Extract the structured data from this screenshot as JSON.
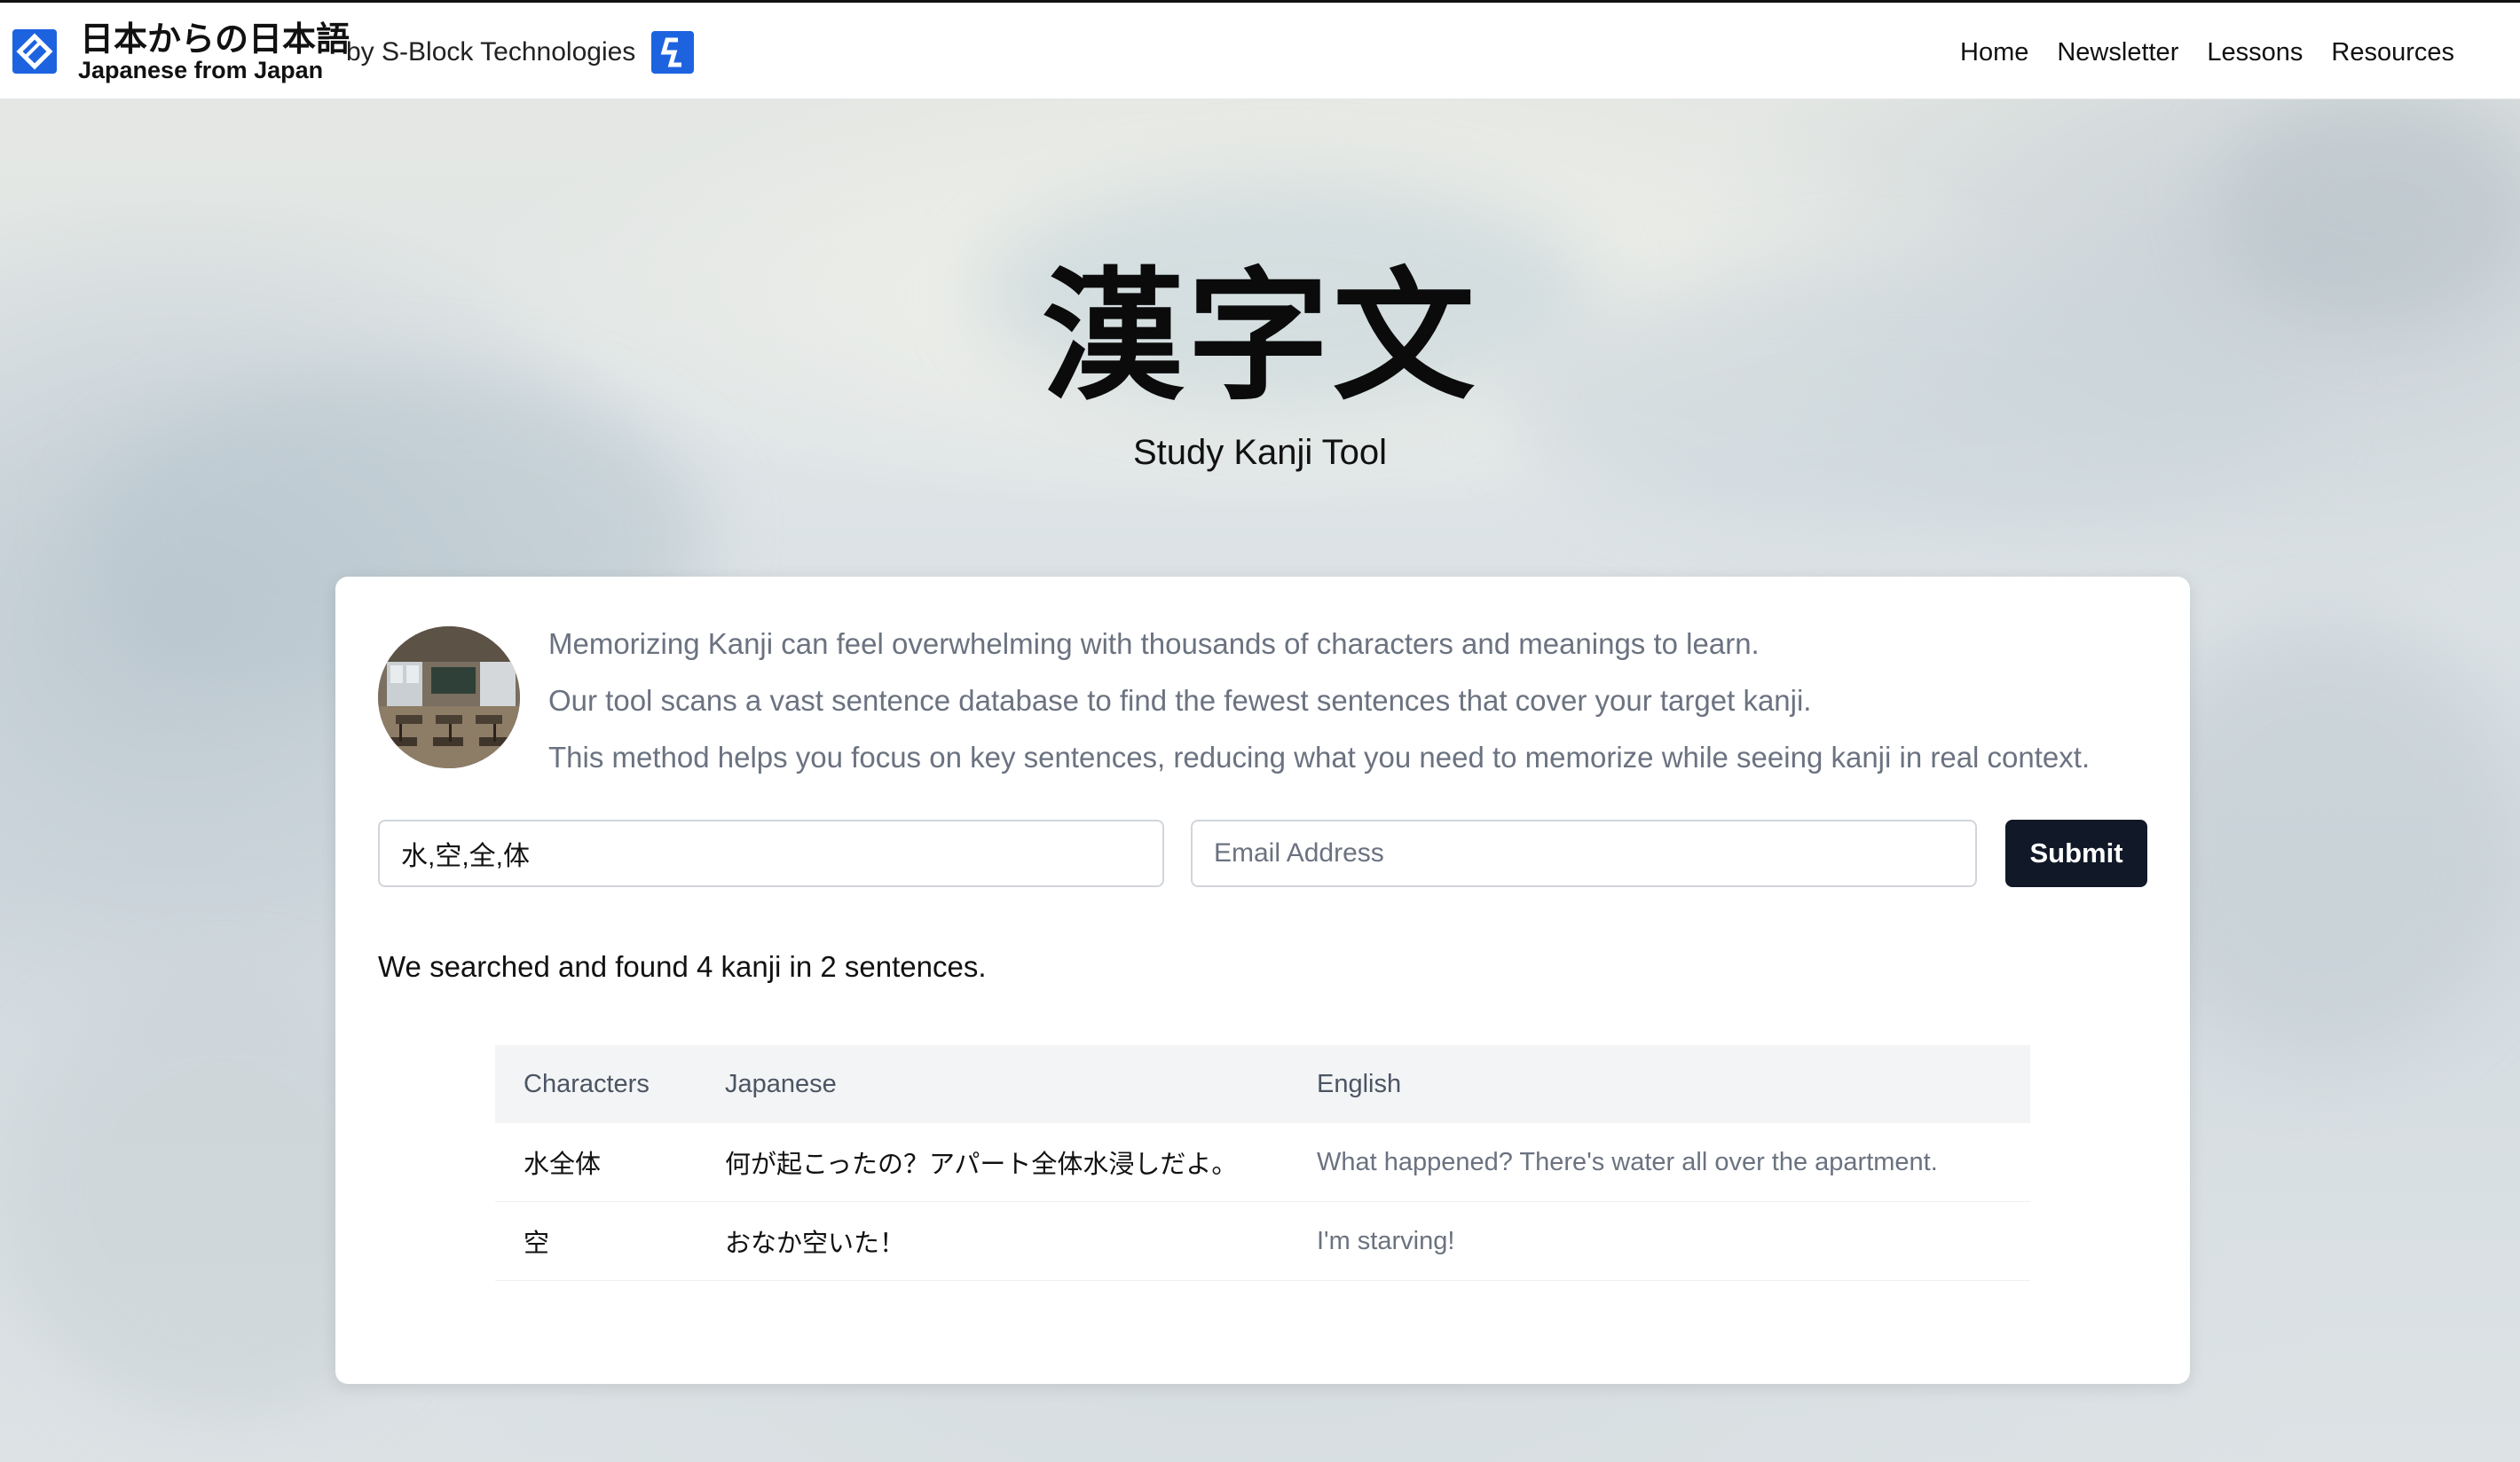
{
  "header": {
    "brand_icon": "diamond-logo-icon",
    "brand_jp": "日本からの日本語",
    "brand_en": "Japanese from Japan",
    "byline": "by S-Block Technologies",
    "sblock_icon": "s-block-logo-icon",
    "nav": [
      "Home",
      "Newsletter",
      "Lessons",
      "Resources"
    ]
  },
  "hero": {
    "title": "漢字文",
    "subtitle": "Study Kanji Tool"
  },
  "intro": {
    "avatar": "classroom-image",
    "lines": [
      "Memorizing Kanji can feel overwhelming with thousands of characters and meanings to learn.",
      "Our tool scans a vast sentence database to find the fewest sentences that cover your target kanji.",
      "This method helps you focus on key sentences, reducing what you need to memorize while seeing kanji in real context."
    ]
  },
  "form": {
    "kanji_value": "水,空,全,体",
    "email_value": "",
    "email_placeholder": "Email Address",
    "submit_label": "Submit"
  },
  "results": {
    "summary": "We searched and found 4 kanji in 2 sentences.",
    "columns": [
      "Characters",
      "Japanese",
      "English"
    ],
    "rows": [
      {
        "characters": "水全体",
        "japanese": "何が起こったの？アパート全体水浸しだよ。",
        "english": "What happened? There's water all over the apartment."
      },
      {
        "characters": "空",
        "japanese": "おなか空いた！",
        "english": "I'm starving!"
      }
    ]
  },
  "colors": {
    "accent": "#1d63e0",
    "button": "#111827",
    "muted_text": "#6b7280",
    "table_header_bg": "#f3f4f6"
  }
}
